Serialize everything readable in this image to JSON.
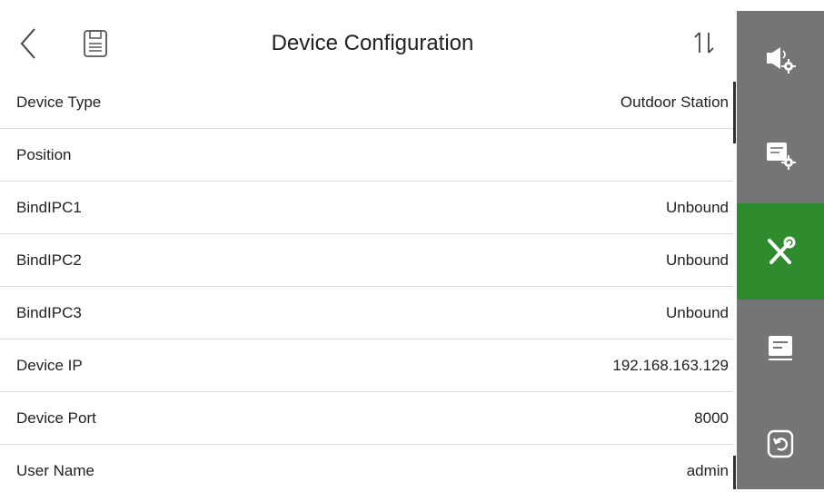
{
  "header": {
    "title": "Device Configuration"
  },
  "rows": [
    {
      "label": "Device Type",
      "value": "Outdoor Station"
    },
    {
      "label": "Position",
      "value": ""
    },
    {
      "label": "BindIPC1",
      "value": "Unbound"
    },
    {
      "label": "BindIPC2",
      "value": "Unbound"
    },
    {
      "label": "BindIPC3",
      "value": "Unbound"
    },
    {
      "label": "Device IP",
      "value": "192.168.163.129"
    },
    {
      "label": "Device Port",
      "value": "8000"
    },
    {
      "label": "User Name",
      "value": "admin"
    }
  ],
  "icons": {
    "back": "chevron-left-icon",
    "save": "save-icon",
    "sort": "sort-icon",
    "sidebar": [
      "sound-settings-icon",
      "config-settings-icon",
      "tools-icon",
      "message-icon",
      "restore-icon"
    ]
  },
  "colors": {
    "sidebar_bg": "#757575",
    "sidebar_active": "#2e8b2e",
    "text": "#222222",
    "divider": "#dcdcdc"
  },
  "sidebar": {
    "active_index": 2
  }
}
